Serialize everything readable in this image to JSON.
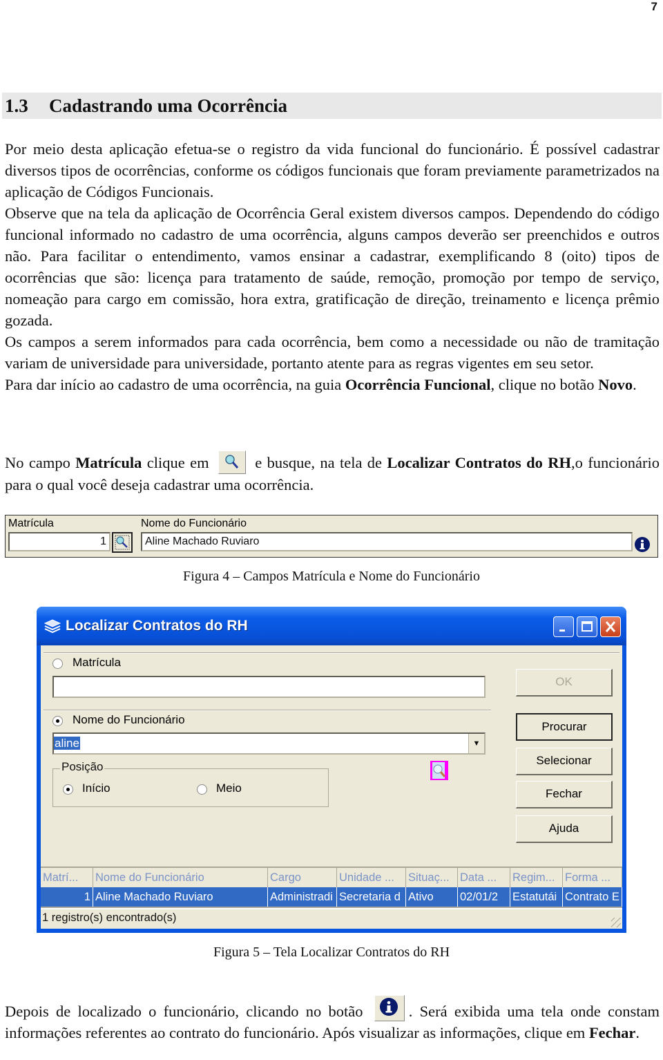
{
  "page_number": "7",
  "section": {
    "number": "1.3",
    "title": "Cadastrando uma Ocorrência"
  },
  "paragraphs": {
    "p1": "Por meio desta aplicação efetua-se o registro da vida funcional do funcionário. É possível cadastrar diversos tipos de ocorrências, conforme os códigos funcionais que foram previamente parametrizados na aplicação de Códigos Funcionais.",
    "p2": "Observe que na tela da aplicação de Ocorrência Geral existem diversos campos. Dependendo do código funcional informado no cadastro de uma ocorrência, alguns campos deverão ser preenchidos e outros não. Para facilitar o entendimento, vamos ensinar a cadastrar, exemplificando 8 (oito) tipos de ocorrências que são: licença para tratamento de saúde, remoção, promoção por tempo de serviço, nomeação para cargo em comissão, hora extra, gratificação de direção, treinamento e licença prêmio gozada.",
    "p3": "Os campos a serem informados para cada ocorrência, bem como a necessidade ou não de tramitação variam de universidade para universidade, portanto atente para as regras vigentes em seu setor.",
    "p4_a": "Para dar início ao cadastro de uma ocorrência, na guia ",
    "p4_b": "Ocorrência Funcional",
    "p4_c": ", clique no botão ",
    "p4_d": "Novo",
    "p4_e": ".",
    "p5_a": "No campo ",
    "p5_b": "Matrícula",
    "p5_c": " clique em ",
    "p5_d": " e busque, na tela de ",
    "p5_e": "Localizar Contratos do RH",
    "p5_f": ",o funcionário para o qual você deseja cadastrar uma ocorrência.",
    "p6_a": "Depois de localizado o funcionário, clicando no botão ",
    "p6_b": ". Será exibida uma tela onde constam informações referentes ao contrato do funcionário. Após visualizar as informações, clique em ",
    "p6_c": "Fechar",
    "p6_d": "."
  },
  "figure4": {
    "matricula_label": "Matrícula",
    "matricula_value": "1",
    "nome_label": "Nome do Funcionário",
    "nome_value": "Aline Machado Ruviaro",
    "caption": "Figura 4 – Campos Matrícula e Nome do Funcionário"
  },
  "figure5": {
    "window_title": "Localizar Contratos do RH",
    "radio_matricula": "Matrícula",
    "matricula_input": "",
    "radio_nome": "Nome do Funcionário",
    "nome_input": "aline",
    "groupbox_title": "Posição",
    "radio_inicio": "Início",
    "radio_meio": "Meio",
    "buttons": {
      "ok": "OK",
      "procurar": "Procurar",
      "selecionar": "Selecionar",
      "fechar": "Fechar",
      "ajuda": "Ajuda"
    },
    "grid": {
      "columns": [
        "Matrí...",
        "Nome do Funcionário",
        "Cargo",
        "Unidade ...",
        "Situaç...",
        "Data ...",
        "Regim...",
        "Forma ..."
      ],
      "rows": [
        [
          "1",
          "Aline Machado Ruviaro",
          "Administradi",
          "Secretaria d",
          "Ativo",
          "02/01/2",
          "Estatutái",
          "Contrato E"
        ]
      ]
    },
    "status": "1 registro(s) encontrado(s)",
    "caption": "Figura 5 – Tela Localizar Contratos do RH"
  },
  "colors": {
    "title_bar": "#0850d6",
    "selection": "#316ac5",
    "dialog_bg": "#ece9d8",
    "heading_bg": "#e8e8e8",
    "close_button": "#c9401a"
  }
}
